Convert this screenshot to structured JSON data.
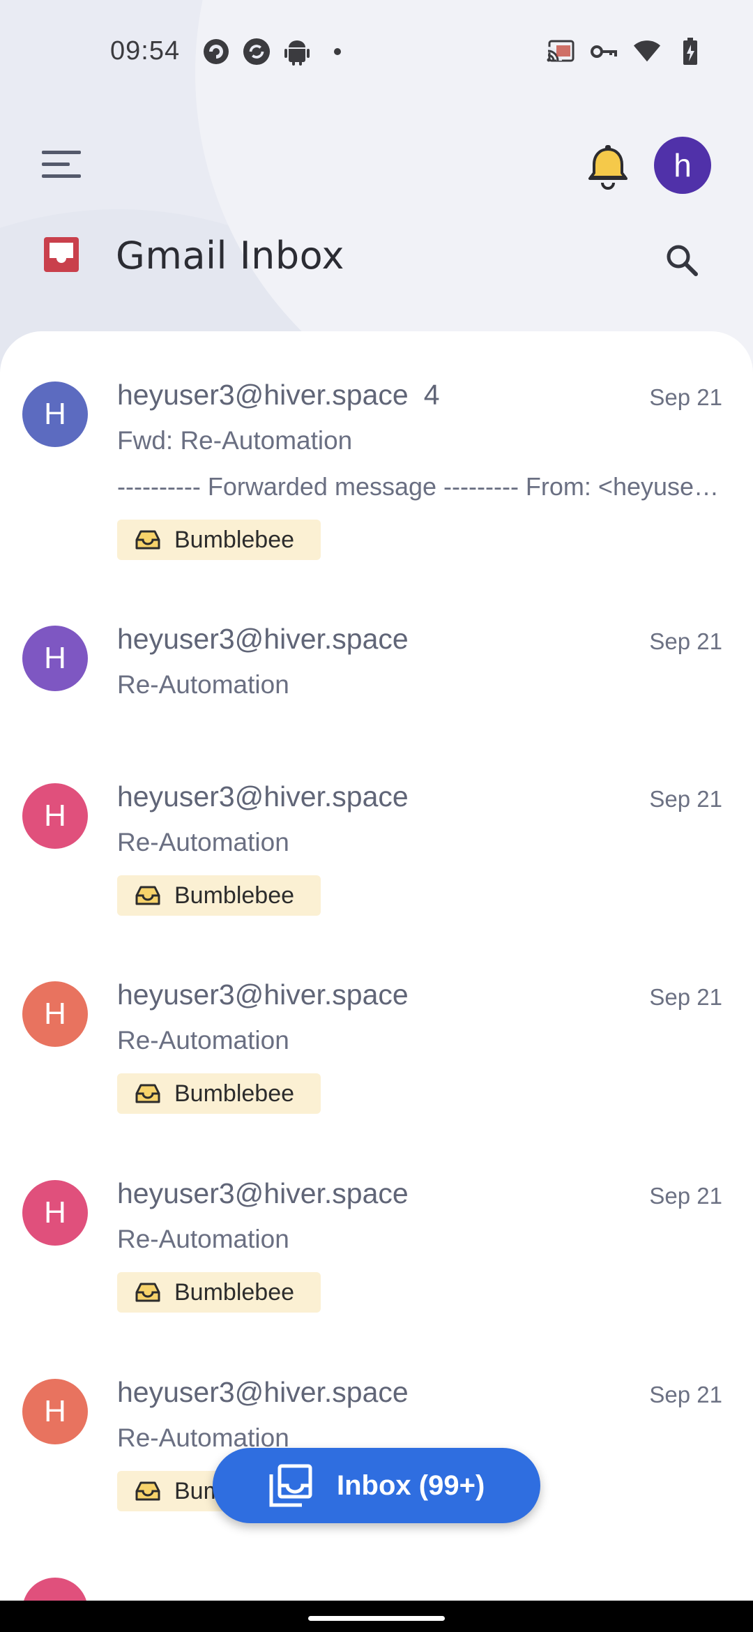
{
  "status_bar": {
    "time": "09:54",
    "left_icons": [
      "pocket-casts-icon",
      "sync-icon",
      "android-icon",
      "dot-icon"
    ],
    "right_icons": [
      "cast-icon",
      "vpn-key-icon",
      "wifi-icon",
      "battery-charging-icon"
    ]
  },
  "top_bar": {
    "menu_icon": "menu-icon",
    "notification_icon": "bell-icon",
    "account_initial": "h",
    "account_color": "#5031a9"
  },
  "header": {
    "title": "Gmail Inbox",
    "inbox_icon": "inbox-icon",
    "inbox_icon_color": "#c9404c",
    "search_icon": "search-icon"
  },
  "emails": [
    {
      "avatar_initial": "H",
      "avatar_color": "#5c6bc0",
      "sender": "heyuser3@hiver.space",
      "thread_count": "4",
      "date": "Sep 21",
      "subject": "Fwd: Re-Automation",
      "snippet": "---------- Forwarded message --------- From: <heyuser3@hiver.space>",
      "label": "Bumblebee"
    },
    {
      "avatar_initial": "H",
      "avatar_color": "#7e57c2",
      "sender": "heyuser3@hiver.space",
      "thread_count": "",
      "date": "Sep 21",
      "subject": "Re-Automation",
      "snippet": "",
      "label": ""
    },
    {
      "avatar_initial": "H",
      "avatar_color": "#e0507c",
      "sender": "heyuser3@hiver.space",
      "thread_count": "",
      "date": "Sep 21",
      "subject": "Re-Automation",
      "snippet": "",
      "label": "Bumblebee"
    },
    {
      "avatar_initial": "H",
      "avatar_color": "#e8735f",
      "sender": "heyuser3@hiver.space",
      "thread_count": "",
      "date": "Sep 21",
      "subject": "Re-Automation",
      "snippet": "",
      "label": "Bumblebee"
    },
    {
      "avatar_initial": "H",
      "avatar_color": "#e0507c",
      "sender": "heyuser3@hiver.space",
      "thread_count": "",
      "date": "Sep 21",
      "subject": "Re-Automation",
      "snippet": "",
      "label": "Bumblebee"
    },
    {
      "avatar_initial": "H",
      "avatar_color": "#e8735f",
      "sender": "heyuser3@hiver.space",
      "thread_count": "",
      "date": "Sep 21",
      "subject": "Re-Automation",
      "snippet": "",
      "label": "Bumblebee"
    }
  ],
  "fab": {
    "label": "Inbox (99+)",
    "icon": "stacked-inbox-icon",
    "color": "#2f6ee0"
  },
  "label_chip_color": "#fbf0d3",
  "label_icon_color": "#b8860b"
}
